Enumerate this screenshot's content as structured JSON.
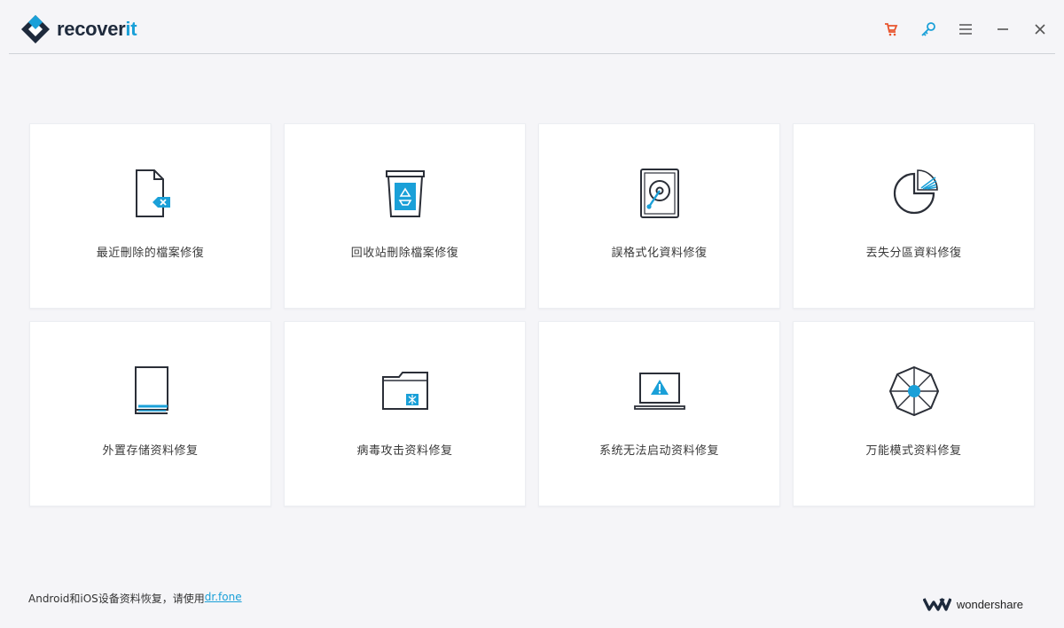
{
  "app": {
    "logo_text_main": "recover",
    "logo_text_accent": "it",
    "icons": [
      "cart-icon",
      "key-icon",
      "menu-icon",
      "minimize-icon",
      "close-icon"
    ],
    "accent_color": "#1aa0d8",
    "cart_color": "#e8542d"
  },
  "cards": [
    {
      "label": "最近刪除的檔案修復",
      "icon": "deleted-file-icon"
    },
    {
      "label": "回收站刪除檔案修復",
      "icon": "recycle-bin-icon"
    },
    {
      "label": "誤格式化資料修復",
      "icon": "hard-drive-icon"
    },
    {
      "label": "丟失分區資料修復",
      "icon": "partition-icon"
    },
    {
      "label": "外置存储资料修复",
      "icon": "external-storage-icon"
    },
    {
      "label": "病毒攻击资料修复",
      "icon": "virus-folder-icon"
    },
    {
      "label": "系统无法启动资料修复",
      "icon": "system-crash-icon"
    },
    {
      "label": "万能模式资料修复",
      "icon": "all-round-icon"
    }
  ],
  "footer": {
    "text": "Android和iOS设备资料恢复，请使用",
    "link": "dr.fone",
    "brand": "wondershare"
  }
}
